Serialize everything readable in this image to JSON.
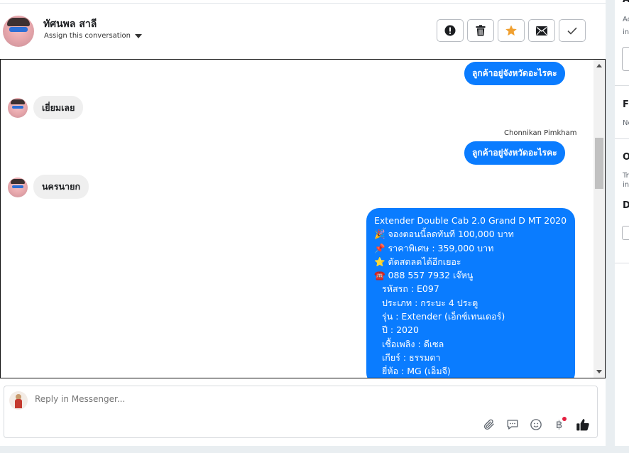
{
  "header": {
    "contact_name": "ทัศนพล สาลี",
    "assign_label": "Assign this conversation"
  },
  "icons": {
    "action_buttons": [
      "alert-icon",
      "trash-icon",
      "star-icon",
      "envelope-icon",
      "check-icon"
    ],
    "reply_tools": [
      "paperclip-icon",
      "comment-icon",
      "emoji-icon",
      "baht-icon",
      "thumbs-up-icon"
    ]
  },
  "colors": {
    "outgoing_bubble": "#0a7cff",
    "incoming_bubble": "#efefef",
    "star_accent": "#f0a030",
    "notification_dot": "#e41e3f"
  },
  "chat": {
    "messages": [
      {
        "direction": "out",
        "text": "ลูกค้าอยู่จังหวัดอะไรคะ"
      },
      {
        "direction": "in",
        "text": "เยี่ยมเลย"
      },
      {
        "direction": "out",
        "sender": "Chonnikan Pimkham",
        "text": "ลูกค้าอยู่จังหวัดอะไรคะ"
      },
      {
        "direction": "in",
        "text": "นครนายก"
      }
    ],
    "offer": {
      "title": "Extender Double Cab 2.0 Grand D MT 2020",
      "lines": [
        {
          "emoji": "🎉",
          "text": " จองตอนนี้ลดทันที 100,000 บาท"
        },
        {
          "emoji": "📌",
          "text": " ราคาพิเศษ : 359,000 บาท"
        },
        {
          "emoji": "⭐",
          "text": " ตัดสดลดได้อีกเยอะ"
        },
        {
          "emoji": "☎️",
          "text": "  088 557 7932 เจ๊หนู"
        }
      ],
      "specs": [
        "รหัสรถ : E097",
        "ประเภท : กระบะ 4 ประตู",
        "รุ่น : Extender (เอ็กซ์เทนเดอร์)",
        "ปี : 2020",
        "เชื้อเพลิง : ดีเซล",
        "เกียร์ : ธรรมดา",
        "ยี่ห้อ : MG (เอ็มจี)"
      ]
    }
  },
  "reply": {
    "placeholder": "Reply in Messenger...",
    "currency_symbol": "฿"
  },
  "right_panel": {
    "heading_1": "A",
    "text_1a": "Ac",
    "text_1b": "in",
    "heading_2": "F",
    "text_2": "No",
    "heading_3": "O",
    "text_3a": "Tra",
    "text_3b": "in",
    "heading_4": "D"
  }
}
